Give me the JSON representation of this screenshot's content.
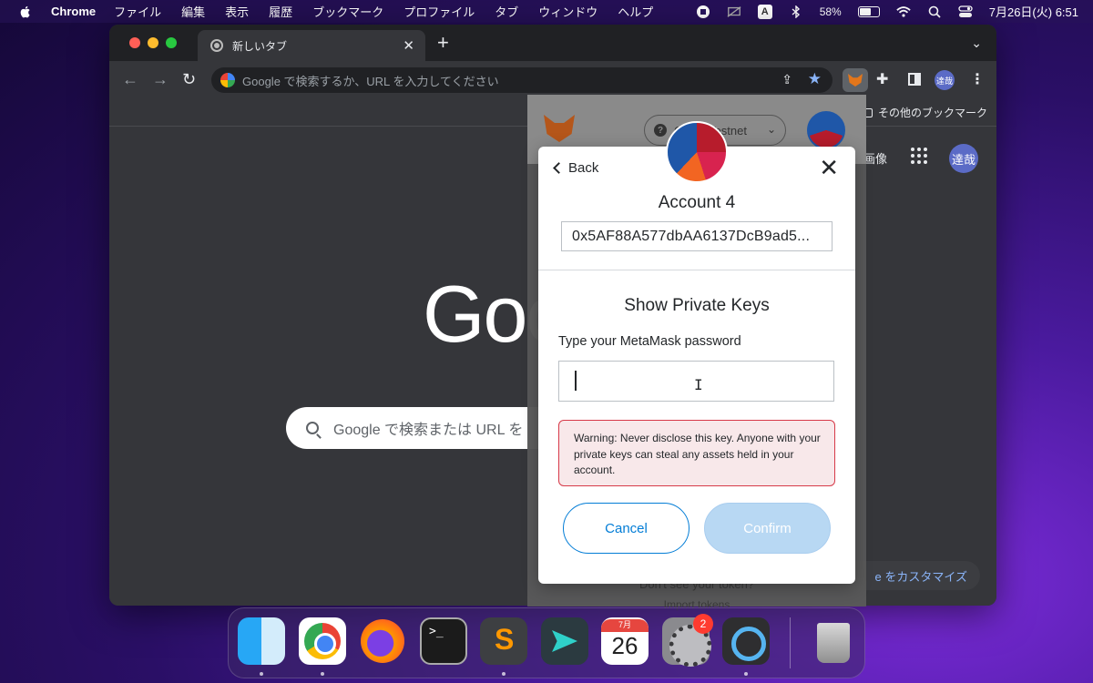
{
  "menubar": {
    "app_name": "Chrome",
    "menus": [
      "ファイル",
      "編集",
      "表示",
      "履歴",
      "ブックマーク",
      "プロファイル",
      "タブ",
      "ウィンドウ",
      "ヘルプ"
    ],
    "input_source": "A",
    "battery": "58%",
    "datetime": "7月26日(火)  6:51"
  },
  "browser": {
    "tab_title": "新しいタブ",
    "tab_close": "✕",
    "new_tab": "+",
    "tab_dropdown": "⌄",
    "back": "←",
    "forward": "→",
    "reload": "↻",
    "omnibox_placeholder": "Google で検索するか、URL を入力してください",
    "share": "⇪",
    "bookmark_star": "★",
    "extensions": "✚",
    "profile": "達哉",
    "menu": "⋮",
    "other_bookmarks": "その他のブックマーク"
  },
  "google": {
    "images_link": "画像",
    "avatar": "達哉",
    "logo_text": "Goo",
    "search_placeholder": "Google で検索または URL を",
    "customize": "e をカスタマイズ"
  },
  "metamask": {
    "network": "Goerli Testnet",
    "network_icon": "?",
    "network_chevron": "⌄",
    "footer_text": "Don't see your token?",
    "footer_link": "Import tokens",
    "modal": {
      "back_label": "Back",
      "close": "✕",
      "account_name": "Account 4",
      "address": "0x5AF88A577dbAA6137DcB9ad5...",
      "heading": "Show Private Keys",
      "password_prompt": "Type your MetaMask password",
      "password_value": "",
      "warning": "Warning: Never disclose this key. Anyone with your private keys can steal any assets held in your account.",
      "cancel_label": "Cancel",
      "confirm_label": "Confirm"
    }
  },
  "dock": {
    "terminal_prompt": ">_",
    "calendar_month": "7月",
    "calendar_day": "26",
    "settings_badge": "2"
  },
  "colors": {
    "metamask_blue": "#037dd6",
    "warning_border": "#d73a49",
    "warning_bg": "#f8e8ea"
  }
}
